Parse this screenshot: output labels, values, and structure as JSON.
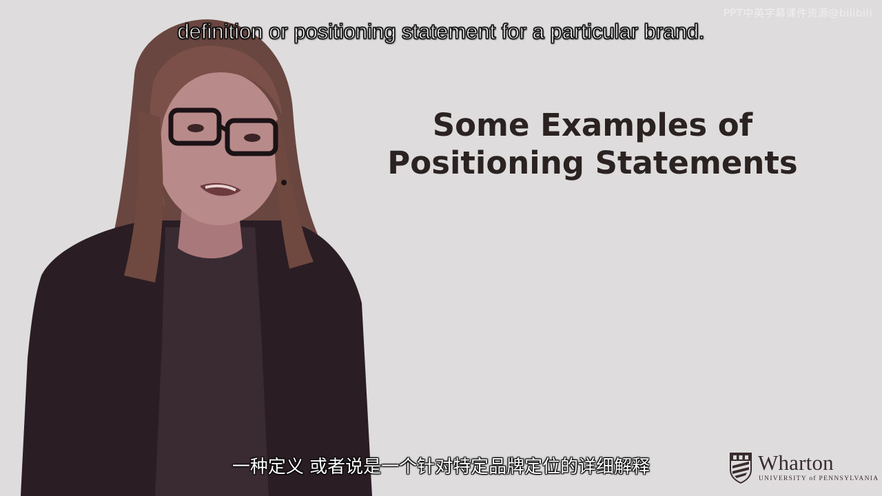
{
  "watermark": "PPT中英字幕课件资源@bilibili",
  "subtitle_en": "definition or positioning statement for a particular brand.",
  "slide": {
    "title_line1": "Some Examples of",
    "title_line2": "Positioning Statements"
  },
  "subtitle_zh": "一种定义 或者说是一个针对特定品牌定位的详细解释",
  "logo": {
    "name": "Wharton",
    "subtitle": "UNIVERSITY of PENNSYLVANIA"
  },
  "colors": {
    "background": "#dedcdd",
    "title": "#2b2222",
    "logo": "#3a2b2f"
  }
}
